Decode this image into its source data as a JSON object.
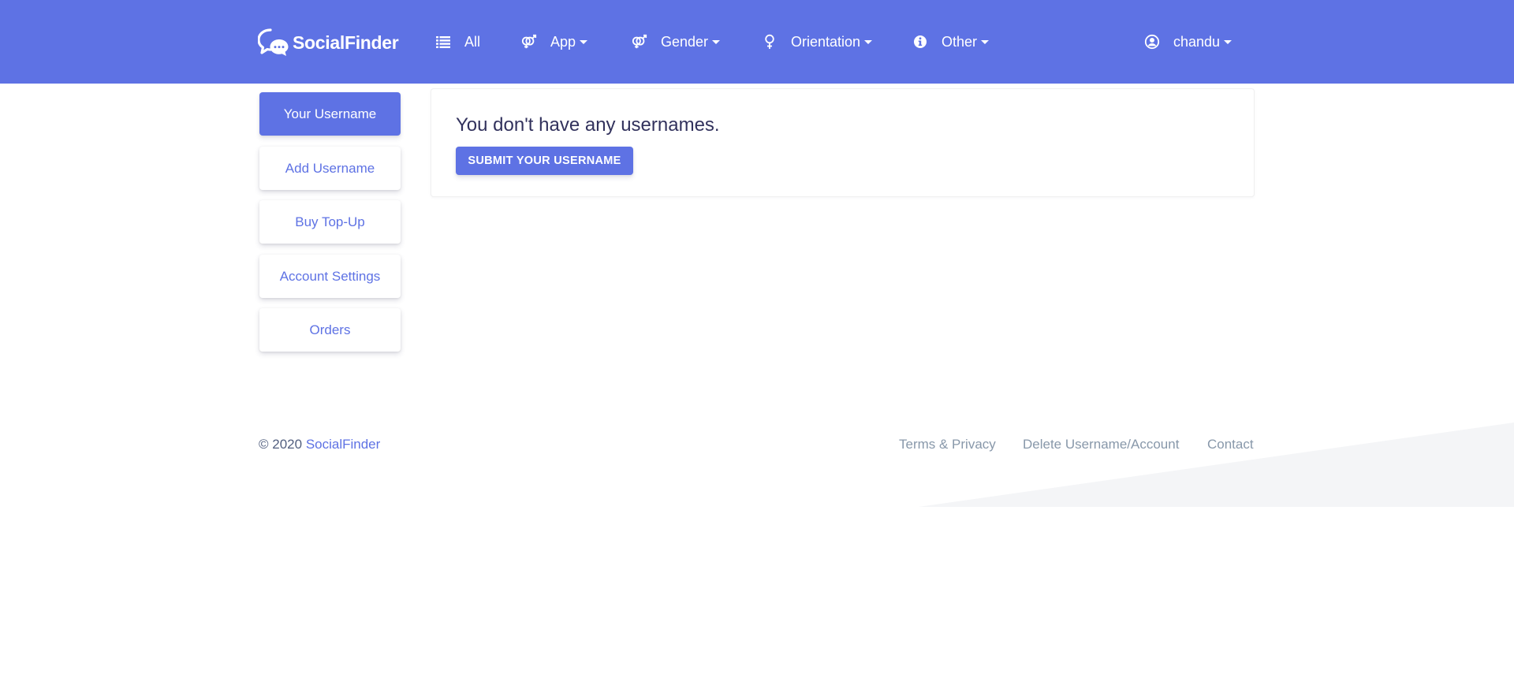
{
  "navbar": {
    "brand": "SocialFinder",
    "items": [
      {
        "label": "All",
        "icon": "list-icon",
        "has_dropdown": false
      },
      {
        "label": "App",
        "icon": "gender-icon",
        "has_dropdown": true
      },
      {
        "label": "Gender",
        "icon": "gender-icon",
        "has_dropdown": true
      },
      {
        "label": "Orientation",
        "icon": "venus-icon",
        "has_dropdown": true
      },
      {
        "label": "Other",
        "icon": "info-icon",
        "has_dropdown": true
      }
    ],
    "user": {
      "label": "chandu",
      "icon": "user-circle-icon"
    },
    "background_color": "#5e72e4"
  },
  "sidebar": {
    "items": [
      {
        "label": "Your Username",
        "active": true
      },
      {
        "label": "Add Username",
        "active": false
      },
      {
        "label": "Buy Top-Up",
        "active": false
      },
      {
        "label": "Account Settings",
        "active": false
      },
      {
        "label": "Orders",
        "active": false
      }
    ]
  },
  "main": {
    "message": "You don't have any usernames.",
    "submit_label": "SUBMIT YOUR USERNAME"
  },
  "footer": {
    "copyright_prefix": "© 2020",
    "copyright_brand": "SocialFinder",
    "links": [
      "Terms & Privacy",
      "Delete Username/Account",
      "Contact"
    ]
  },
  "colors": {
    "primary": "#5e72e4",
    "text_dark": "#32325d",
    "text_muted": "#8898aa",
    "footer_shape": "#f4f5f7"
  }
}
